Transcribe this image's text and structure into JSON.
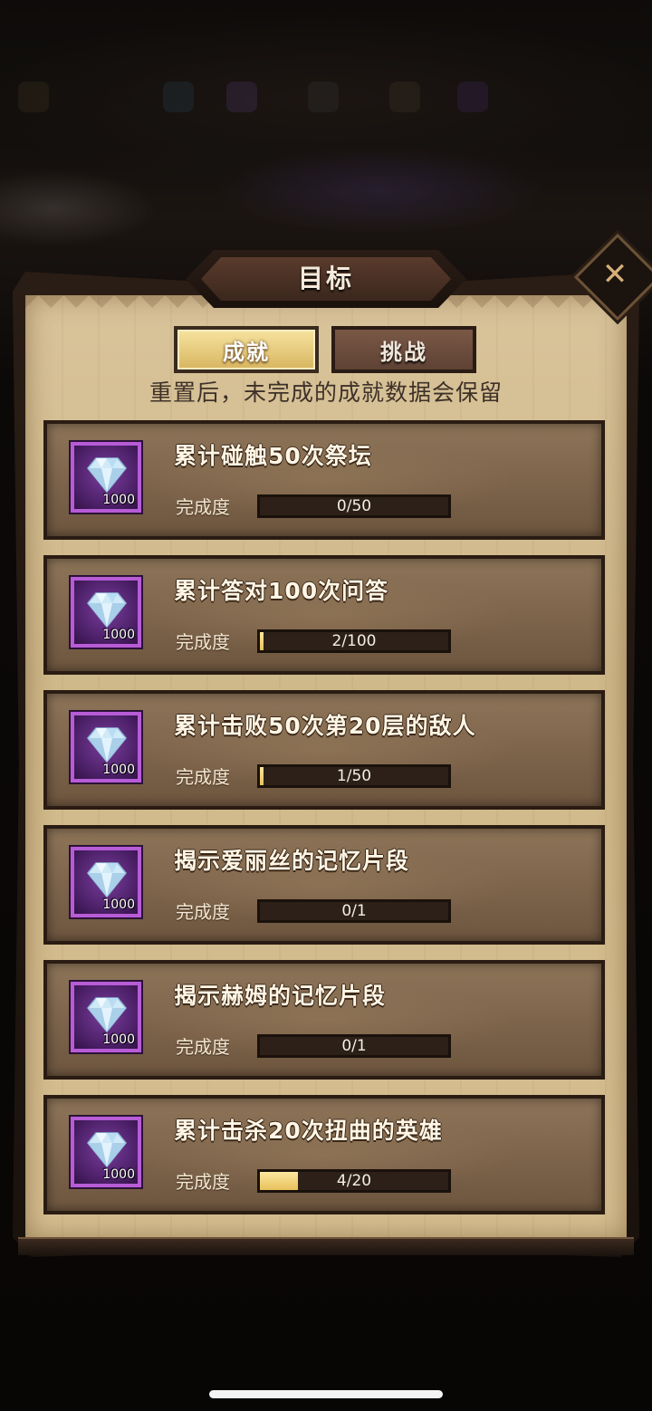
{
  "dialog": {
    "title": "目标",
    "tabs": [
      {
        "label": "成就",
        "active": true
      },
      {
        "label": "挑战",
        "active": false
      }
    ],
    "notice": "重置后，未完成的成就数据会保留",
    "progress_label": "完成度",
    "close_icon": "close-icon"
  },
  "achievements": [
    {
      "title": "累计碰触50次祭坛",
      "reward_icon": "diamond-icon",
      "reward_count": "1000",
      "progress_text": "0/50",
      "progress": 0.0
    },
    {
      "title": "累计答对100次问答",
      "reward_icon": "diamond-icon",
      "reward_count": "1000",
      "progress_text": "2/100",
      "progress": 0.02
    },
    {
      "title": "累计击败50次第20层的敌人",
      "reward_icon": "diamond-icon",
      "reward_count": "1000",
      "progress_text": "1/50",
      "progress": 0.02
    },
    {
      "title": "揭示爱丽丝的记忆片段",
      "reward_icon": "diamond-icon",
      "reward_count": "1000",
      "progress_text": "0/1",
      "progress": 0.0
    },
    {
      "title": "揭示赫姆的记忆片段",
      "reward_icon": "diamond-icon",
      "reward_count": "1000",
      "progress_text": "0/1",
      "progress": 0.0
    },
    {
      "title": "累计击杀20次扭曲的英雄",
      "reward_icon": "diamond-icon",
      "reward_count": "1000",
      "progress_text": "4/20",
      "progress": 0.2
    }
  ],
  "colors": {
    "panel": "#d9c39a",
    "card": "#7a6149",
    "reward_border": "#b75cd6",
    "progress_fill": "#e8c15a",
    "active_tab": "#d8b560"
  }
}
